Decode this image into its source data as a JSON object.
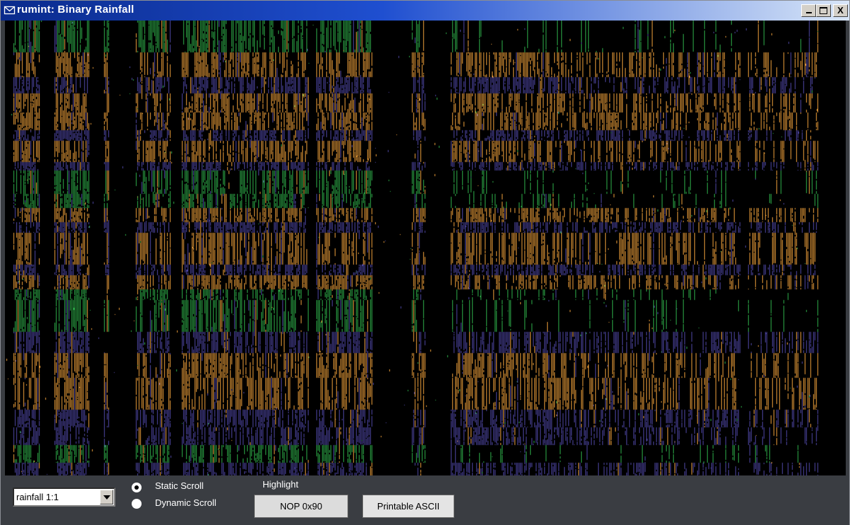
{
  "window": {
    "title": "rumint: Binary Rainfall",
    "minimize_label": "_",
    "close_label": "X",
    "titlebar_icon": "envelope-icon"
  },
  "colors": {
    "titlebar_start": "#0a2a8c",
    "titlebar_end": "#d8e6f8",
    "green": "#2fb24a",
    "orange": "#f2a23a",
    "purple": "#5048a8",
    "background": "#000000",
    "panel": "#3a3d42"
  },
  "controls": {
    "view_select": {
      "value": "rainfall 1:1",
      "icon": "chevron-down-icon"
    },
    "scroll_mode": {
      "options": [
        {
          "label": "Static Scroll",
          "checked": true
        },
        {
          "label": "Dynamic Scroll",
          "checked": false
        }
      ]
    },
    "highlight": {
      "label": "Highlight",
      "buttons": [
        "NOP 0x90",
        "Printable ASCII"
      ]
    }
  }
}
